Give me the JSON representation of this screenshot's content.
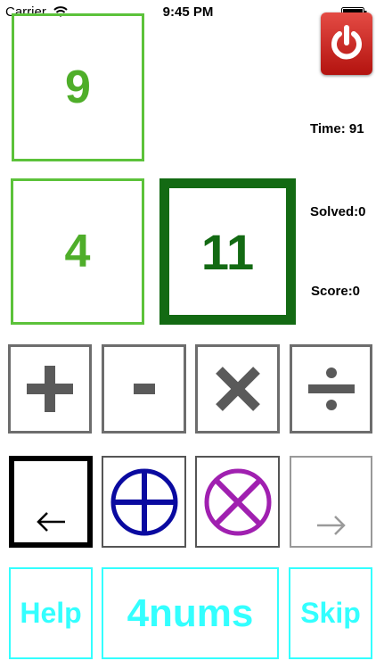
{
  "status_bar": {
    "carrier": "Carrier",
    "time": "9:45 PM"
  },
  "tiles": {
    "top": "9",
    "bottom_left": "4",
    "bottom_right": "11"
  },
  "stats": {
    "time": "Time: 91",
    "solved": "Solved:0",
    "score": "Score:0"
  },
  "bottom_bar": {
    "help": "Help",
    "title": "4nums",
    "skip": "Skip"
  },
  "colors": {
    "tile_light": "#5cc23a",
    "tile_dark": "#136a13",
    "accent_cyan": "#33ffff",
    "power_red": "#d42a24",
    "plus_circle": "#0a0aa0",
    "times_circle": "#a020b0"
  },
  "icons": {
    "power": "power-icon",
    "plus": "plus-icon",
    "minus": "minus-icon",
    "times": "times-icon",
    "divide": "divide-icon",
    "undo": "arrow-left-icon",
    "redo": "arrow-right-icon",
    "plus_circle": "circled-plus-icon",
    "times_circle": "circled-times-icon"
  }
}
